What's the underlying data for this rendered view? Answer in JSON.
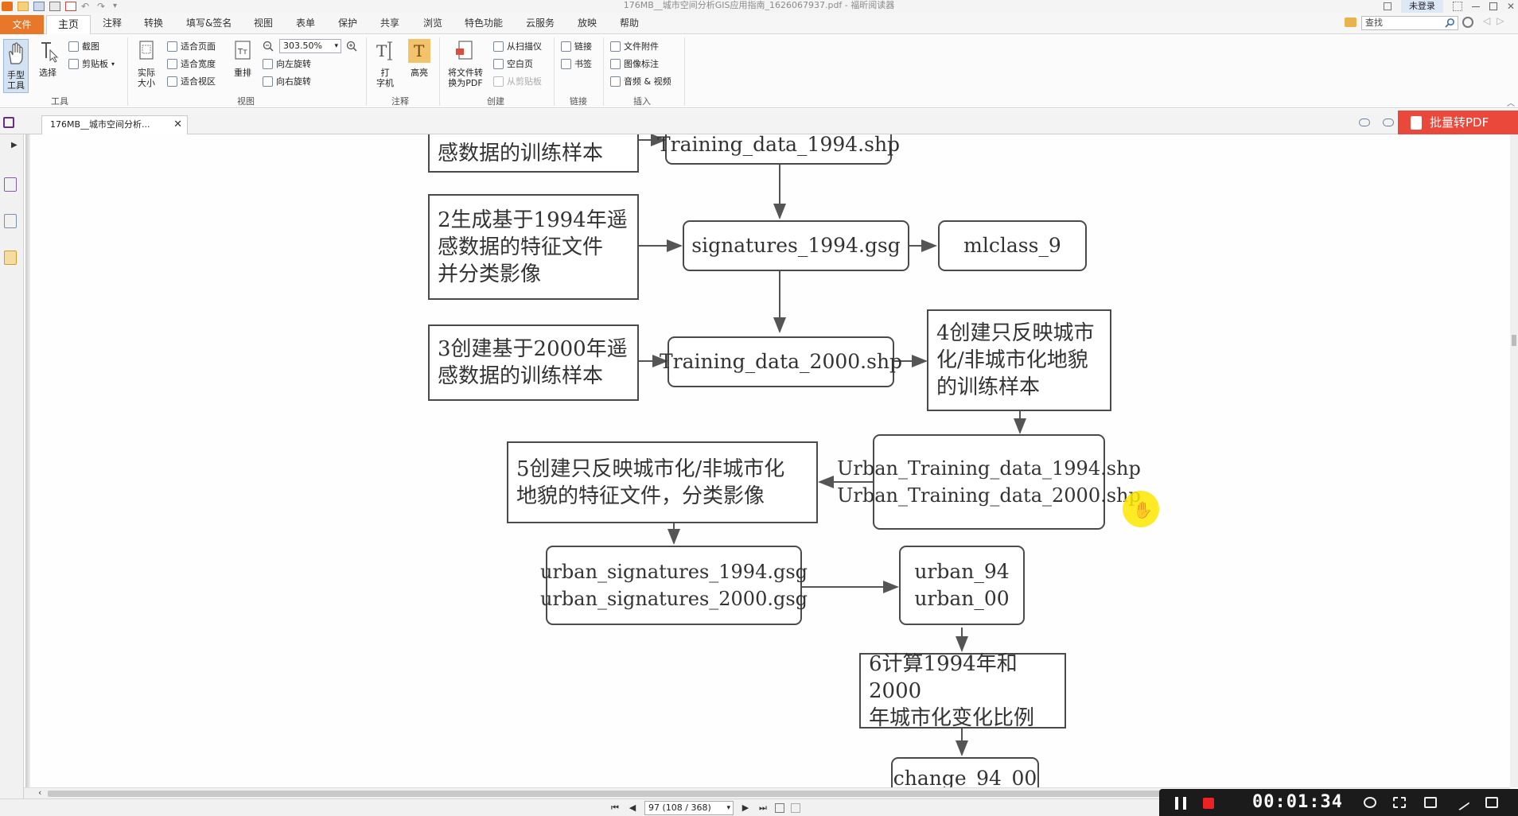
{
  "titlebar": {
    "title": "176MB__城市空间分析GIS应用指南_1626067937.pdf - 福昕阅读器",
    "login": "未登录"
  },
  "menu": {
    "file": "文件",
    "tabs": [
      "主页",
      "注释",
      "转换",
      "填写&签名",
      "视图",
      "表单",
      "保护",
      "共享",
      "浏览",
      "特色功能",
      "云服务",
      "放映",
      "帮助"
    ],
    "search_placeholder": "查找"
  },
  "ribbon": {
    "hand_tool": "手型\n工具",
    "select": "选择",
    "screenshot": "截图",
    "clipboard": "剪贴板",
    "actual_size": "实际\n大小",
    "fit_page": "适合页面",
    "fit_width": "适合宽度",
    "fit_view": "适合视区",
    "reflow": "重排",
    "zoom_value": "303.50%",
    "rotate_left": "向左旋转",
    "rotate_right": "向右旋转",
    "typewriter": "打\n字机",
    "highlight": "高亮",
    "file_to_pdf": "将文件转\n换为PDF",
    "from_scanner": "从扫描仪",
    "blank_page": "空白页",
    "from_clipboard": "从剪贴板",
    "link": "链接",
    "bookmark": "书签",
    "file_attachment": "文件附件",
    "image_annotation": "图像标注",
    "audio_video": "音频 & 视频",
    "groups": {
      "tools": "工具",
      "view": "视图",
      "comment": "注释",
      "create": "创建",
      "links": "链接",
      "insert": "插入"
    }
  },
  "doc_tab": {
    "label": "176MB__城市空间分析..."
  },
  "batch_button": "批量转PDF",
  "flowchart": {
    "b_top_left": "感数据的训练样本",
    "b_top_mid": "Training_data_1994.shp",
    "b2": "2生成基于1994年遥\n感数据的特征文件\n并分类影像",
    "sig1994": "signatures_1994.gsg",
    "mlclass": "mlclass_9",
    "b3": "3创建基于2000年遥\n感数据的训练样本",
    "td2000": "Training_data_2000.shp",
    "b4": "4创建只反映城市\n化/非城市化地貌\n的训练样本",
    "urban_td": "Urban_Training_data_1994.shp\nUrban_Training_data_2000.shp",
    "b5": "5创建只反映城市化/非城市化\n地貌的特征文件，分类影像",
    "urban_sig": "urban_signatures_1994.gsg\nurban_signatures_2000.gsg",
    "urban_94": "urban_94\nurban_00",
    "b6": "6计算1994年和2000\n年城市化变化比例",
    "change": "change_94_00"
  },
  "statusbar": {
    "page_indicator": "97 (108 / 368)"
  },
  "recorder": {
    "time": "00:01:34"
  }
}
